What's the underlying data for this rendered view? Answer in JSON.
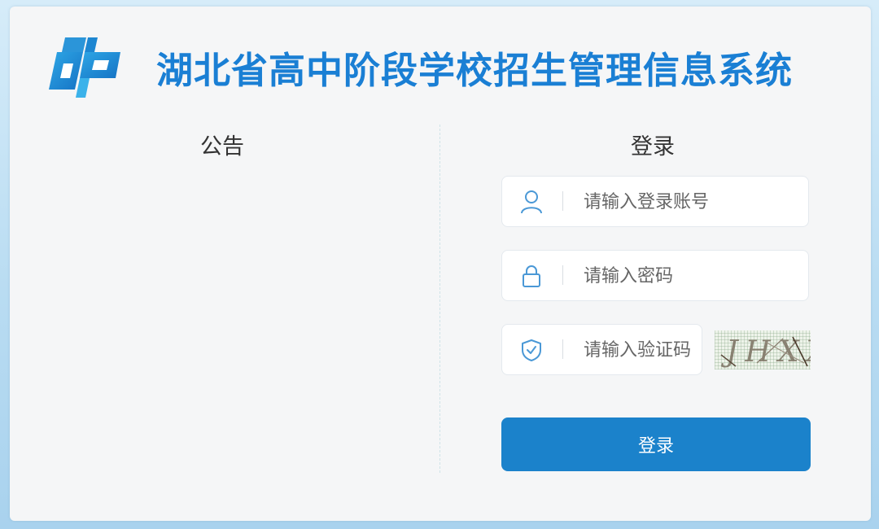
{
  "header": {
    "title": "湖北省高中阶段学校招生管理信息系统",
    "logo_icon": "cp-logo-icon"
  },
  "notice": {
    "heading": "公告"
  },
  "login": {
    "heading": "登录",
    "account_placeholder": "请输入登录账号",
    "account_icon": "user-icon",
    "password_placeholder": "请输入密码",
    "password_icon": "lock-icon",
    "captcha_placeholder": "请输入验证码",
    "captcha_icon": "shield-check-icon",
    "captcha_text": "JHXX",
    "submit_label": "登录"
  },
  "colors": {
    "accent": "#1b82cb",
    "title": "#1a7fd4",
    "icon": "#4a98d6"
  }
}
